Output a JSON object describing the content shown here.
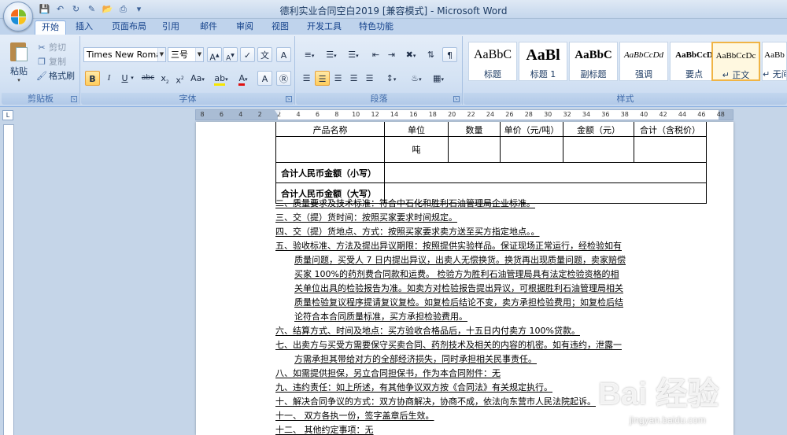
{
  "window": {
    "title": "德利实业合同空白2019 [兼容模式] - Microsoft Word"
  },
  "tabs": [
    "开始",
    "插入",
    "页面布局",
    "引用",
    "邮件",
    "审阅",
    "视图",
    "开发工具",
    "特色功能"
  ],
  "clipboard": {
    "paste": "粘贴",
    "cut": "剪切",
    "copy": "复制",
    "format_painter": "格式刷",
    "label": "剪贴板"
  },
  "font": {
    "name": "Times New Romar",
    "size": "三号",
    "label": "字体"
  },
  "paragraph": {
    "label": "段落"
  },
  "styles": {
    "label": "样式",
    "items": [
      {
        "sample": "AaBbC",
        "name": "标题"
      },
      {
        "sample": "AaBl",
        "name": "标题 1"
      },
      {
        "sample": "AaBbC",
        "name": "副标题"
      },
      {
        "sample": "AaBbCcDd",
        "name": "强调"
      },
      {
        "sample": "AaBbCcD",
        "name": "要点"
      },
      {
        "sample": "AaBbCcDc",
        "name": "↵ 正文"
      },
      {
        "sample": "AaBb",
        "name": "↵ 无间"
      }
    ]
  },
  "ruler": {
    "numbers": [
      "8",
      "6",
      "4",
      "2",
      "2",
      "4",
      "6",
      "8",
      "10",
      "12",
      "14",
      "16",
      "18",
      "20",
      "22",
      "24",
      "26",
      "28",
      "30",
      "32",
      "34",
      "36",
      "38",
      "40",
      "42",
      "44",
      "46",
      "48"
    ]
  },
  "document": {
    "table": {
      "header": [
        "产品名称",
        "单位",
        "数量",
        "单价（元/吨）",
        "金额（元）",
        "合计（含税价）"
      ],
      "unit": "吨",
      "total_small": "合计人民币金额（小写）",
      "total_big": "合计人民币金额（大写）"
    },
    "clauses": [
      "二、质量要求及技术标准：符合中石化和胜利石油管理局企业标准。",
      "三、交（提）货时间：按照买家要求时间规定。",
      "四、交（提）货地点、方式：按照买家要求卖方送至买方指定地点。。",
      "五、验收标准、方法及提出异议期限：按照提供实验样品。保证现场正常运行，经检验如有",
      "质量问题，买受人 7 日内提出异议，出卖人无偿换货。换货再出现质量问题，卖家赔偿",
      "买家  100%的药剂费合同款和运费。  检验方为胜利石油管理局具有法定检验资格的相",
      "关单位出具的检验报告为准。如卖方对检验报告提出异议，可根据胜利石油管理局相关",
      "质量检验复议程序提请复议复检。如复检后结论不变，卖方承担检验费用；如复检后结",
      "论符合本合同质量标准，买方承担检验费用。",
      "六、结算方式、时间及地点：买方验收合格品后，十五日内付卖方 100%贷款。",
      "七、出卖方与买受方需要保守买卖合同、药剂技术及相关的内容的机密。如有违约，泄露一",
      "方需承担其带给对方的全部经济损失，同时承担相关民事责任。",
      "八、如需提供担保，另立合同担保书，作为本合同附件：无",
      "九、违约责任：如上所述，有其他争议双方按《合同法》有关规定执行。",
      "十、解决合同争议的方式：双方协商解决，协商不成，依法向东营市人民法院起诉。",
      "十一、    双方各执一份，签字盖章后生效。",
      "十二、    其他约定事项：无"
    ]
  },
  "watermark": {
    "text": "Bai 经验",
    "sub": "jingyan.baidu.com"
  }
}
